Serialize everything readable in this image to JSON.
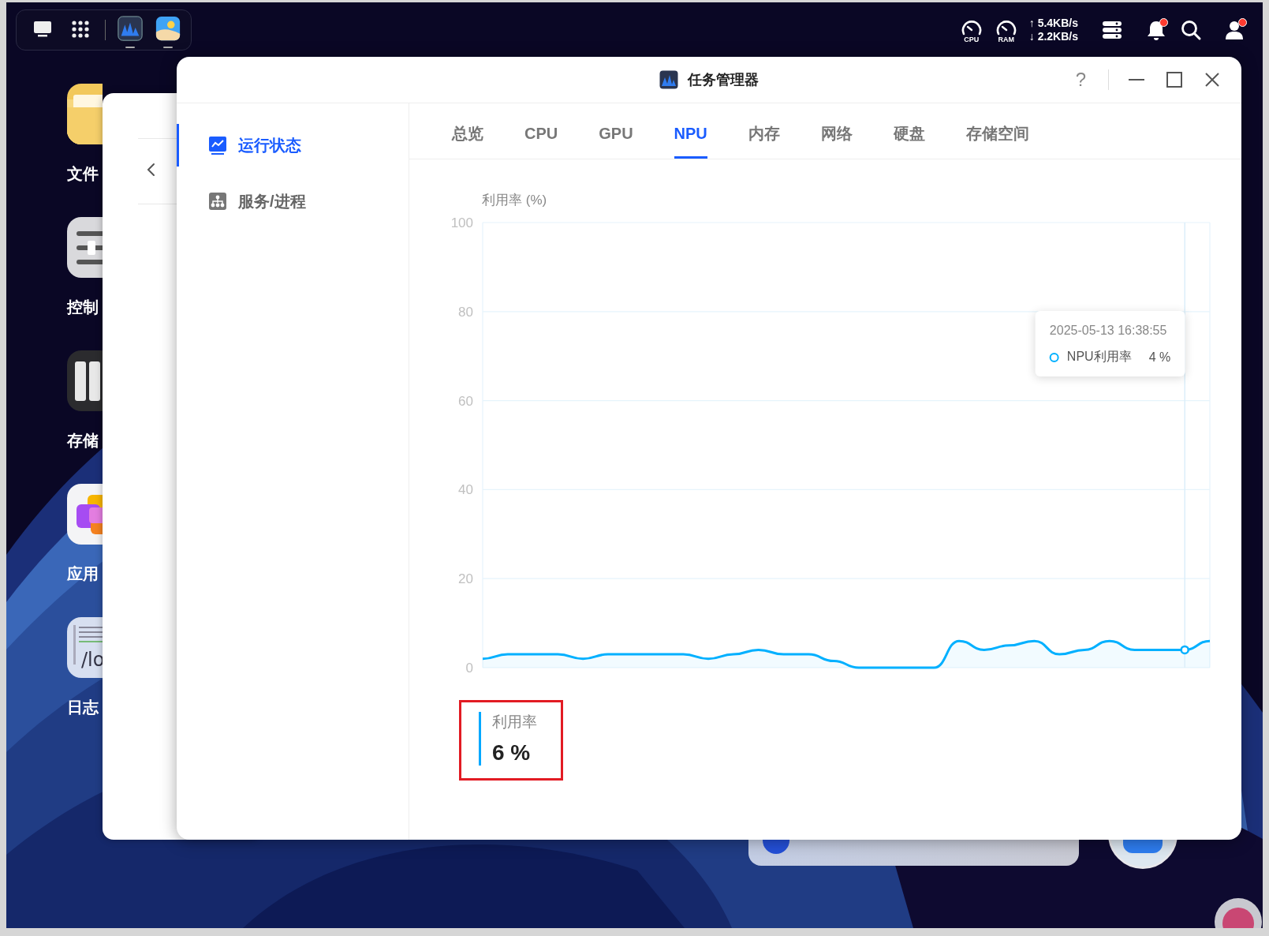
{
  "top_bar": {
    "dock": [
      {
        "kind": "monitor",
        "running": false
      },
      {
        "kind": "grid",
        "running": false
      },
      {
        "kind": "task-manager",
        "running": true
      },
      {
        "kind": "photos",
        "running": true
      }
    ],
    "status": {
      "cpu_label": "CPU",
      "ram_label": "RAM",
      "upload": "↑ 5.4KB/s",
      "download": "↓ 2.2KB/s",
      "notifications_unread": true,
      "account_alert": true
    }
  },
  "desktop_icons": [
    {
      "kind": "folder",
      "label": "文件"
    },
    {
      "kind": "sliders",
      "label": "控制"
    },
    {
      "kind": "storage",
      "label": "存储"
    },
    {
      "kind": "apps",
      "label": "应用"
    },
    {
      "kind": "log",
      "label": "日志",
      "glyph": "/lo"
    }
  ],
  "window": {
    "title": "任务管理器",
    "help": "?"
  },
  "sidebar": {
    "items": [
      {
        "kind": "chart",
        "label": "运行状态",
        "selected": true
      },
      {
        "kind": "tree",
        "label": "服务/进程",
        "selected": false
      }
    ]
  },
  "tabs": [
    {
      "label": "总览",
      "selected": false
    },
    {
      "label": "CPU",
      "selected": false
    },
    {
      "label": "GPU",
      "selected": false
    },
    {
      "label": "NPU",
      "selected": true
    },
    {
      "label": "内存",
      "selected": false
    },
    {
      "label": "网络",
      "selected": false
    },
    {
      "label": "硬盘",
      "selected": false
    },
    {
      "label": "存储空间",
      "selected": false
    }
  ],
  "chart": {
    "chart_data": {
      "type": "area",
      "ylabel": "利用率 (%)",
      "ylim": [
        0,
        100
      ],
      "yticks": [
        0,
        20,
        40,
        60,
        80,
        100
      ],
      "series": [
        {
          "name": "NPU利用率",
          "color": "#00b0ff",
          "values": [
            2,
            3,
            3,
            3,
            2,
            3,
            3,
            3,
            3,
            2,
            3,
            4,
            3,
            3,
            1.5,
            0,
            0,
            0,
            0,
            6,
            4,
            5,
            6,
            3,
            4,
            6,
            4,
            4,
            4,
            6
          ]
        }
      ],
      "grid": true
    },
    "tooltip": {
      "time": "2025-05-13 16:38:55",
      "value": "4 %"
    }
  },
  "stat": {
    "label": "利用率",
    "value": "6 %",
    "highlighted": true
  }
}
